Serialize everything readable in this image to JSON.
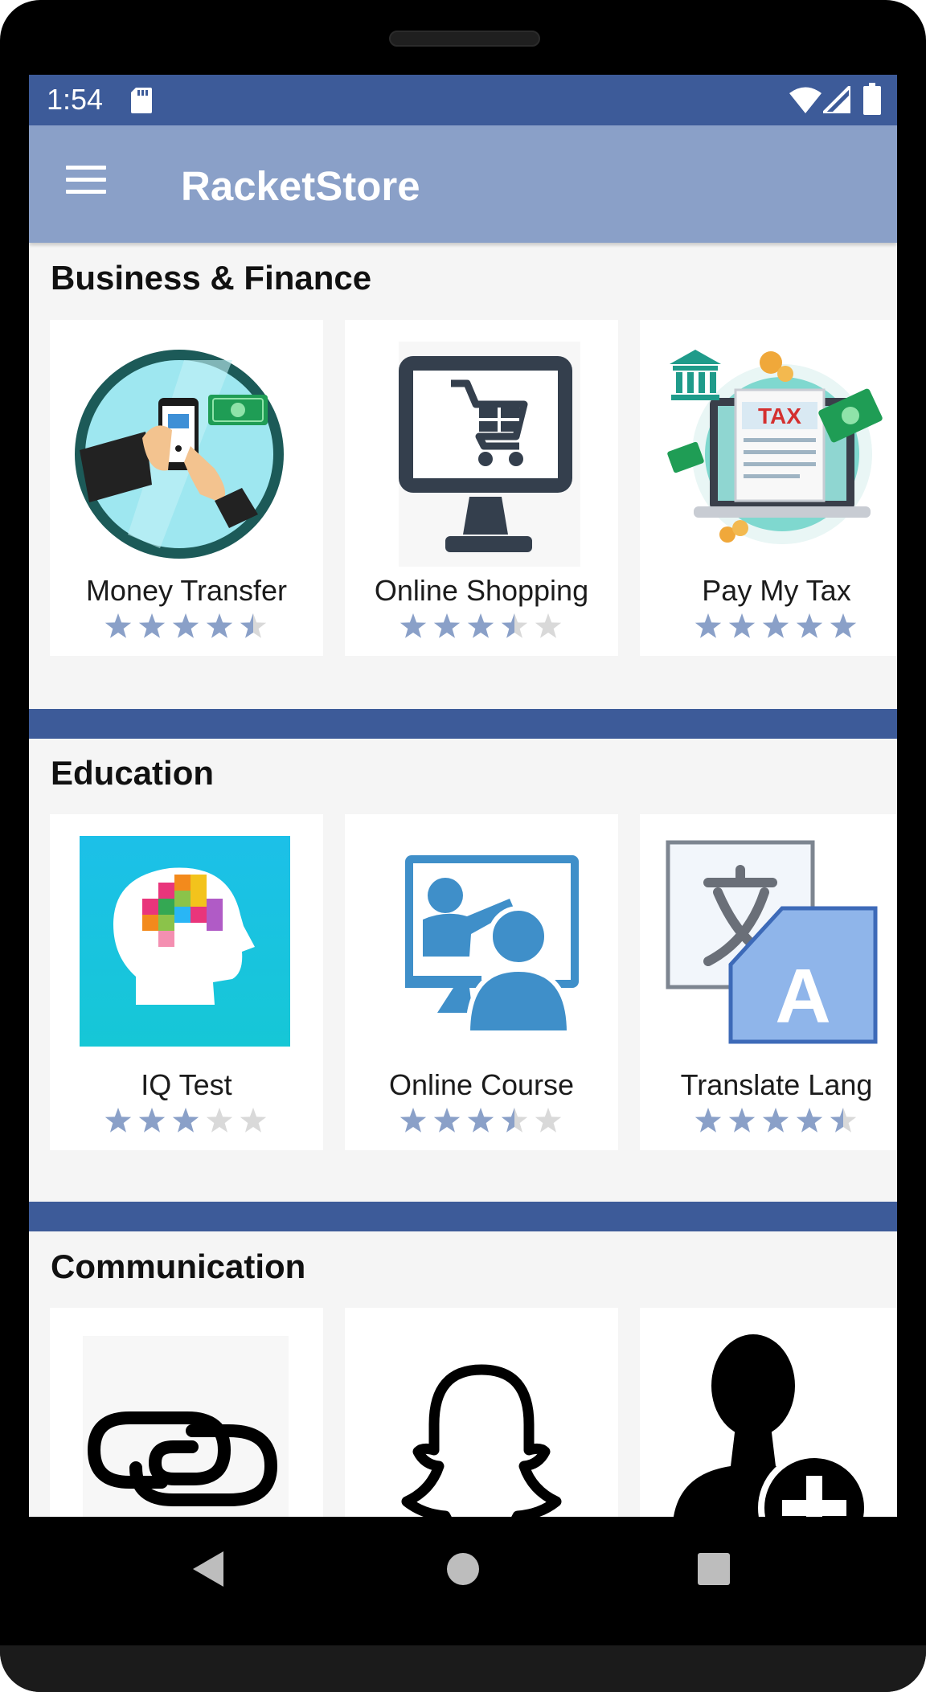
{
  "status": {
    "time": "1:54"
  },
  "app": {
    "title": "RacketStore"
  },
  "colors": {
    "statusbar": "#3d5b99",
    "appbar": "#8aa0c8",
    "star_filled": "#8aa0c8",
    "star_empty": "#d9d9d9"
  },
  "sections": [
    {
      "title": "Business & Finance",
      "apps": [
        {
          "name": "Money Transfer",
          "rating": 4.5,
          "icon": "money-transfer-icon"
        },
        {
          "name": "Online Shopping",
          "rating": 3.5,
          "icon": "shopping-cart-icon"
        },
        {
          "name": "Pay My Tax",
          "rating": 5,
          "icon": "tax-icon"
        }
      ]
    },
    {
      "title": "Education",
      "apps": [
        {
          "name": "IQ Test",
          "rating": 3,
          "icon": "brain-icon"
        },
        {
          "name": "Online Course",
          "rating": 3.5,
          "icon": "teacher-icon"
        },
        {
          "name": "Translate Lang",
          "rating": 4.5,
          "icon": "translate-icon"
        }
      ]
    },
    {
      "title": "Communication",
      "apps": [
        {
          "icon": "linked-rings-icon"
        },
        {
          "icon": "ghost-icon"
        },
        {
          "icon": "add-person-icon"
        }
      ]
    }
  ]
}
